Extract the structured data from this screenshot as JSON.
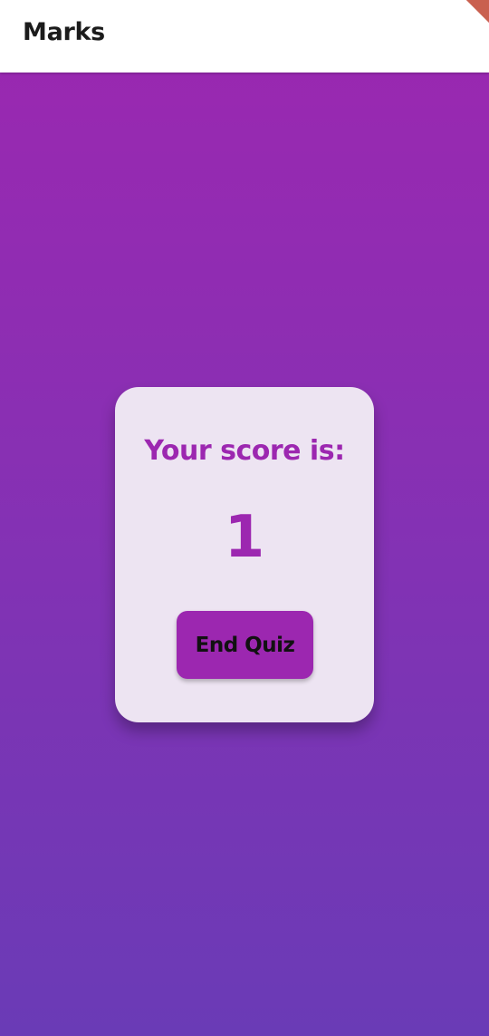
{
  "app_bar": {
    "title": "Marks"
  },
  "score_card": {
    "label": "Your score is:",
    "score": "1",
    "end_button_label": "End Quiz"
  },
  "colors": {
    "primary": "#9c27b0",
    "gradient_top": "#9c27b0",
    "gradient_bottom": "#6a3bb6",
    "card_background": "#ede4f2"
  }
}
